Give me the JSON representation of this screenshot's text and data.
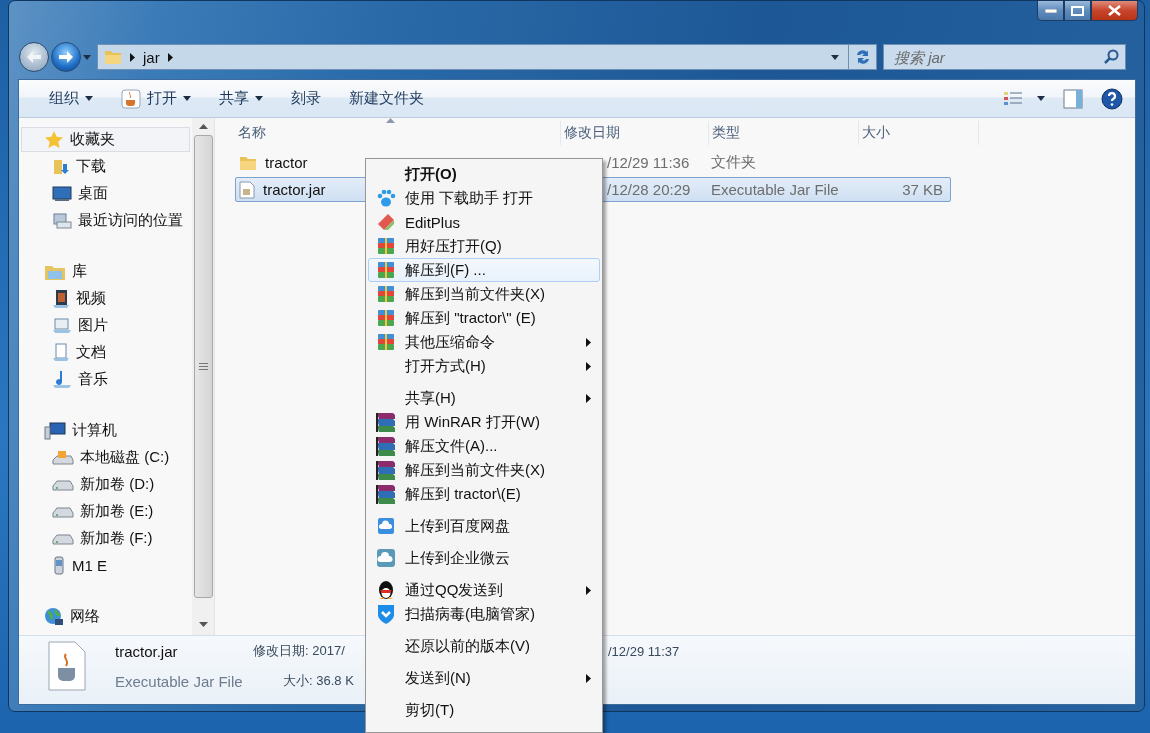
{
  "address": {
    "crumbs": [
      "jar"
    ]
  },
  "search": {
    "placeholder": "搜索 jar"
  },
  "toolbar": {
    "buttons": [
      {
        "label": "组织",
        "dropdown": true
      },
      {
        "label": "打开",
        "dropdown": true
      },
      {
        "label": "共享",
        "dropdown": true
      },
      {
        "label": "刻录",
        "dropdown": false
      },
      {
        "label": "新建文件夹",
        "dropdown": false
      }
    ]
  },
  "sidebar": {
    "groups": [
      {
        "label": "收藏夹",
        "selected": true,
        "children": [
          {
            "label": "下载",
            "selected": false
          },
          {
            "label": "桌面",
            "selected": false
          },
          {
            "label": "最近访问的位置",
            "selected": false
          }
        ]
      },
      {
        "label": "库",
        "selected": false,
        "children": [
          {
            "label": "视频",
            "selected": false
          },
          {
            "label": "图片",
            "selected": false
          },
          {
            "label": "文档",
            "selected": false
          },
          {
            "label": "音乐",
            "selected": false
          }
        ]
      },
      {
        "label": "计算机",
        "selected": false,
        "children": [
          {
            "label": "本地磁盘 (C:)",
            "selected": false
          },
          {
            "label": "新加卷 (D:)",
            "selected": false
          },
          {
            "label": "新加卷 (E:)",
            "selected": false
          },
          {
            "label": "新加卷 (F:)",
            "selected": false
          },
          {
            "label": "M1 E",
            "selected": false
          }
        ]
      },
      {
        "label": "网络",
        "selected": false
      }
    ]
  },
  "table": {
    "columns": [
      "名称",
      "修改日期",
      "类型",
      "大小"
    ],
    "rows": [
      {
        "name": "tractor",
        "date": "/12/29 11:36",
        "type": "文件夹",
        "selected": false
      },
      {
        "name": "tractor.jar",
        "date": "/12/28 20:29",
        "type": "Executable Jar File",
        "size": "37 KB",
        "selected": true
      }
    ]
  },
  "details": {
    "name": "tractor.jar",
    "type": "Executable Jar File",
    "modified": "修改日期: 2017/",
    "modified_rest": "/12/29 11:37",
    "size": "大小: 36.8 K"
  },
  "context_menu": {
    "items": [
      {
        "kind": "item",
        "label": "打开(O)",
        "bold": true,
        "submenu": false,
        "hovered": false
      },
      {
        "kind": "item",
        "label": "使用 下载助手 打开",
        "bold": false,
        "submenu": false,
        "hovered": false
      },
      {
        "kind": "item",
        "label": "EditPlus",
        "bold": false,
        "submenu": false,
        "hovered": false
      },
      {
        "kind": "item",
        "label": "用好压打开(Q)",
        "bold": false,
        "submenu": false,
        "hovered": false
      },
      {
        "kind": "item",
        "label": "解压到(F) ...",
        "bold": false,
        "submenu": false,
        "hovered": true
      },
      {
        "kind": "item",
        "label": "解压到当前文件夹(X)",
        "bold": false,
        "submenu": false,
        "hovered": false
      },
      {
        "kind": "item",
        "label": "解压到 \"tractor\\\" (E)",
        "bold": false,
        "submenu": false,
        "hovered": false
      },
      {
        "kind": "item",
        "label": "其他压缩命令",
        "bold": false,
        "submenu": true,
        "hovered": false
      },
      {
        "kind": "item",
        "label": "打开方式(H)",
        "bold": false,
        "submenu": true,
        "hovered": false
      },
      {
        "kind": "separator"
      },
      {
        "kind": "item",
        "label": "共享(H)",
        "bold": false,
        "submenu": true,
        "hovered": false
      },
      {
        "kind": "item",
        "label": "用 WinRAR 打开(W)",
        "bold": false,
        "submenu": false,
        "hovered": false
      },
      {
        "kind": "item",
        "label": "解压文件(A)...",
        "bold": false,
        "submenu": false,
        "hovered": false
      },
      {
        "kind": "item",
        "label": "解压到当前文件夹(X)",
        "bold": false,
        "submenu": false,
        "hovered": false
      },
      {
        "kind": "item",
        "label": "解压到 tractor\\(E)",
        "bold": false,
        "submenu": false,
        "hovered": false
      },
      {
        "kind": "separator"
      },
      {
        "kind": "item",
        "label": "上传到百度网盘",
        "bold": false,
        "submenu": false,
        "hovered": false
      },
      {
        "kind": "separator"
      },
      {
        "kind": "item",
        "label": "上传到企业微云",
        "bold": false,
        "submenu": false,
        "hovered": false
      },
      {
        "kind": "separator"
      },
      {
        "kind": "item",
        "label": "通过QQ发送到",
        "bold": false,
        "submenu": true,
        "hovered": false
      },
      {
        "kind": "item",
        "label": "扫描病毒(电脑管家)",
        "bold": false,
        "submenu": false,
        "hovered": false
      },
      {
        "kind": "separator"
      },
      {
        "kind": "item",
        "label": "还原以前的版本(V)",
        "bold": false,
        "submenu": false,
        "hovered": false
      },
      {
        "kind": "separator"
      },
      {
        "kind": "item",
        "label": "发送到(N)",
        "bold": false,
        "submenu": true,
        "hovered": false
      },
      {
        "kind": "separator"
      },
      {
        "kind": "item",
        "label": "剪切(T)",
        "bold": false,
        "submenu": false,
        "hovered": false
      }
    ]
  }
}
